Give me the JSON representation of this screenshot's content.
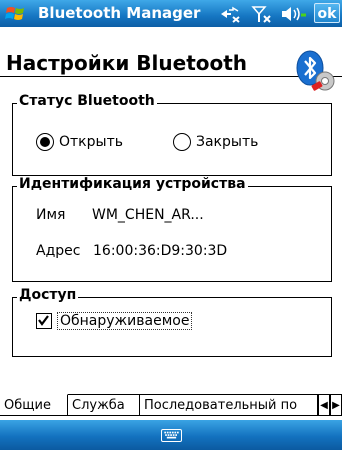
{
  "titlebar": {
    "app_title": "Bluetooth Manager",
    "ok_label": "ok",
    "icons": [
      "windows-start-icon",
      "connectivity-icon",
      "signal-icon",
      "volume-icon"
    ]
  },
  "header": {
    "title": "Настройки Bluetooth",
    "icon": "bluetooth-settings-icon"
  },
  "status_group": {
    "title": "Статус Bluetooth",
    "options": [
      {
        "label": "Открыть",
        "selected": true
      },
      {
        "label": "Закрыть",
        "selected": false
      }
    ]
  },
  "identity_group": {
    "title": "Идентификация устройства",
    "name_label": "Имя",
    "name_value": "WM_CHEN_AR...",
    "address_label": "Адрес",
    "address_value": "16:00:36:D9:30:3D"
  },
  "access_group": {
    "title": "Доступ",
    "discoverable_label": "Обнаруживаемое",
    "discoverable_checked": true
  },
  "tabs": [
    {
      "label": "Общие",
      "active": true
    },
    {
      "label": "Служба",
      "active": false
    },
    {
      "label": "Последовательный по",
      "active": false
    }
  ],
  "bottombar": {
    "icon": "keyboard-icon"
  },
  "colors": {
    "bar_blue": "#1576c2",
    "bluetooth_blue": "#1a6fd0"
  }
}
